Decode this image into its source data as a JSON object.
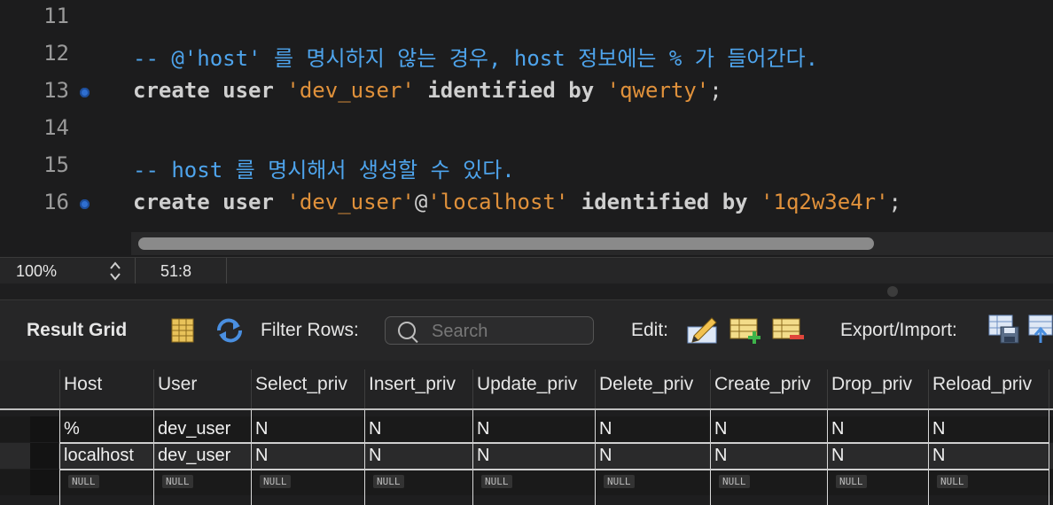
{
  "editor": {
    "lines": [
      {
        "num": "11",
        "breakpoint": false,
        "tokens": []
      },
      {
        "num": "12",
        "breakpoint": false,
        "tokens": [
          {
            "t": "-- @'host' 를 명시하지 않는 경우, host 정보에는 % 가 들어간다.",
            "c": "cm"
          }
        ]
      },
      {
        "num": "13",
        "breakpoint": true,
        "tokens": [
          {
            "t": "create user ",
            "c": "kw"
          },
          {
            "t": "'dev_user'",
            "c": "str"
          },
          {
            "t": " identified by ",
            "c": "kw"
          },
          {
            "t": "'qwerty'",
            "c": "str"
          },
          {
            "t": ";",
            "c": "plain"
          }
        ]
      },
      {
        "num": "14",
        "breakpoint": false,
        "tokens": []
      },
      {
        "num": "15",
        "breakpoint": false,
        "tokens": [
          {
            "t": "-- host 를 명시해서 생성할 수 있다.",
            "c": "cm"
          }
        ]
      },
      {
        "num": "16",
        "breakpoint": true,
        "tokens": [
          {
            "t": "create user ",
            "c": "kw"
          },
          {
            "t": "'dev_user'",
            "c": "str"
          },
          {
            "t": "@",
            "c": "plain"
          },
          {
            "t": "'localhost'",
            "c": "str"
          },
          {
            "t": " identified by ",
            "c": "kw"
          },
          {
            "t": "'1q2w3e4r'",
            "c": "str"
          },
          {
            "t": ";",
            "c": "plain"
          }
        ]
      }
    ]
  },
  "status": {
    "zoom": "100%",
    "cursor_position": "51:8"
  },
  "toolbar": {
    "title": "Result Grid",
    "filter_label": "Filter Rows:",
    "search_placeholder": "Search",
    "edit_label": "Edit:",
    "export_label": "Export/Import:"
  },
  "grid": {
    "columns": [
      "Host",
      "User",
      "Select_priv",
      "Insert_priv",
      "Update_priv",
      "Delete_priv",
      "Create_priv",
      "Drop_priv",
      "Reload_priv"
    ],
    "rows": [
      [
        "%",
        "dev_user",
        "N",
        "N",
        "N",
        "N",
        "N",
        "N",
        "N"
      ],
      [
        "localhost",
        "dev_user",
        "N",
        "N",
        "N",
        "N",
        "N",
        "N",
        "N"
      ]
    ],
    "null_label": "NULL"
  },
  "colors": {
    "comment": "#4ea4ec",
    "string": "#e0913b",
    "keyword": "#cfcfcf",
    "breakpoint": "#2f6fd1"
  }
}
